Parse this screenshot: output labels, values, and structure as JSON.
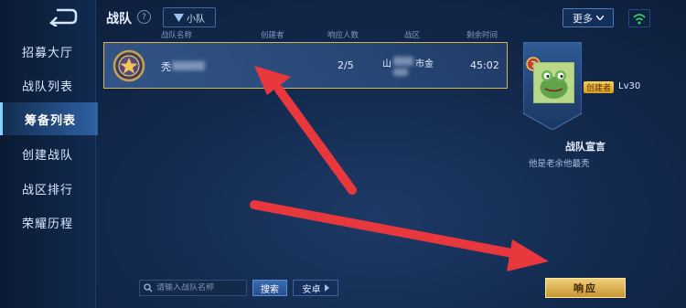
{
  "header": {
    "title": "战队",
    "mode_tag": "小队",
    "more_label": "更多"
  },
  "sidebar": {
    "items": [
      {
        "label": "招募大厅",
        "active": false
      },
      {
        "label": "战队列表",
        "active": false
      },
      {
        "label": "筹备列表",
        "active": true
      },
      {
        "label": "创建战队",
        "active": false
      },
      {
        "label": "战区排行",
        "active": false
      },
      {
        "label": "荣耀历程",
        "active": false
      }
    ]
  },
  "table": {
    "columns": [
      "战队名称",
      "创建者",
      "响应人数",
      "战区",
      "剩余时间"
    ],
    "rows": [
      {
        "name": "秃",
        "creator": "",
        "responses": "2/5",
        "region_prefix": "山",
        "region_suffix": "市金",
        "time_left": "45:02"
      }
    ]
  },
  "detail": {
    "rank": "7",
    "creator_badge": "创建者",
    "level": "Lv30",
    "declaration_title": "战队宣言",
    "declaration_text": "他是老余他最秃"
  },
  "search": {
    "placeholder": "请输入战队名称",
    "button": "搜索",
    "region_button": "安卓"
  },
  "actions": {
    "respond": "响应"
  },
  "colors": {
    "accent_gold": "#d9b35a",
    "annotation_arrow": "#e8383d"
  }
}
